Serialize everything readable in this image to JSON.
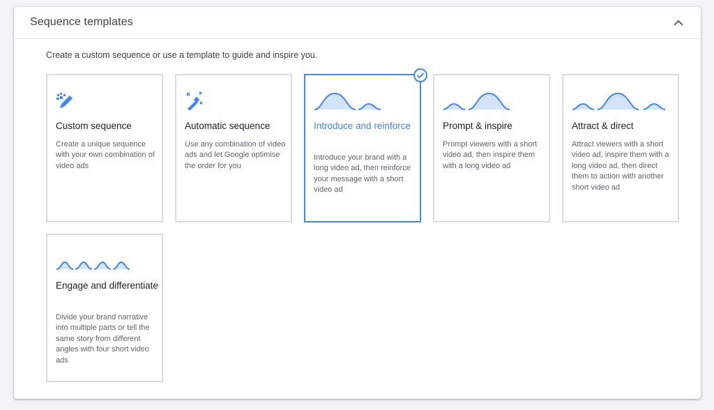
{
  "section": {
    "title": "Sequence templates",
    "intro": "Create a custom sequence or use a template to guide and inspire you."
  },
  "cards": [
    {
      "title": "Custom sequence",
      "description": "Create a unique sequence with your own combination of video ads",
      "icon": "edit-sparkle-icon",
      "selected": false
    },
    {
      "title": "Automatic sequence",
      "description": "Use any combination of video ads and let Google optimise the order for you",
      "icon": "magic-wand-icon",
      "selected": false
    },
    {
      "title": "Introduce and reinforce",
      "description": "Introduce your brand with a long video ad, then reinforce your message with a short video ad",
      "icon": "long-short-waves-icon",
      "selected": true
    },
    {
      "title": "Prompt & inspire",
      "description": "Prompt viewers with a short video ad, then inspire them with a long video ad",
      "icon": "short-long-waves-icon",
      "selected": false
    },
    {
      "title": "Attract & direct",
      "description": "Attract viewers with a short video ad, inspire them with a long video ad, then direct them to action with another short video ad",
      "icon": "short-long-short-waves-icon",
      "selected": false
    },
    {
      "title": "Engage and differentiate",
      "description": "Divide your brand narrative into multiple parts or tell the same story from different angles with four short video ads",
      "icon": "four-short-waves-icon",
      "selected": false
    }
  ],
  "colors": {
    "accent": "#4285f4",
    "wave_fill": "#d2e3fc",
    "selected_title": "#4a7fd8"
  }
}
